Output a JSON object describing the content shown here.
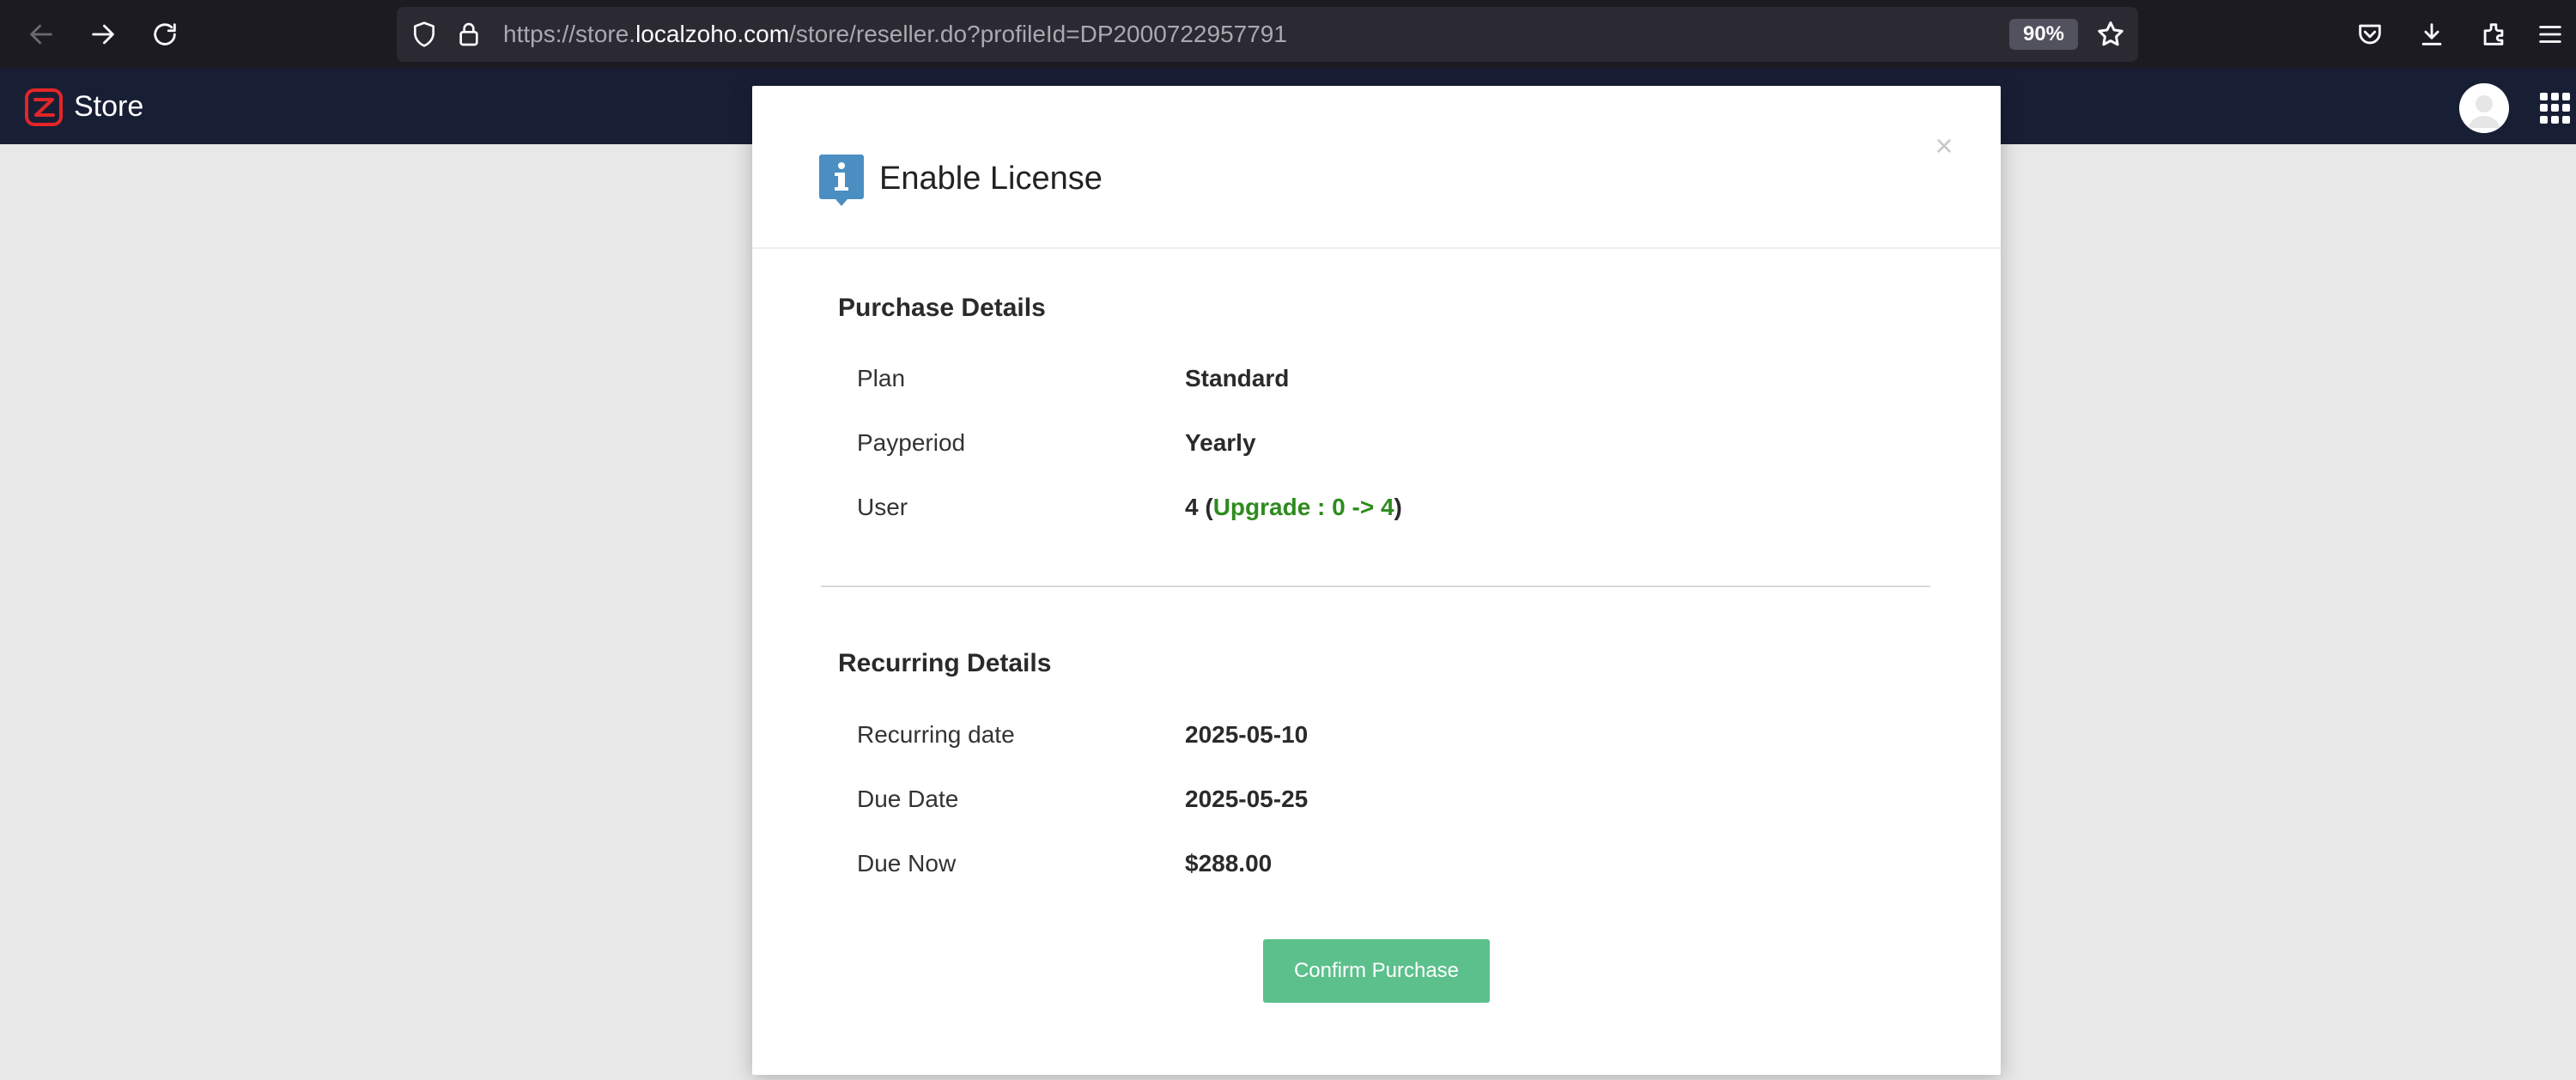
{
  "browser": {
    "url_prefix": "https://store.",
    "url_host": "localzoho.com",
    "url_path": "/store/reseller.do?profileId=DP2000722957791",
    "zoom": "90%"
  },
  "app": {
    "brand": "Store"
  },
  "modal": {
    "title": "Enable License",
    "close_symbol": "×",
    "purchase_details": {
      "title": "Purchase Details",
      "plan_label": "Plan",
      "plan_value": "Standard",
      "payperiod_label": "Payperiod",
      "payperiod_value": "Yearly",
      "user_label": "User",
      "user_count": "4",
      "user_open": " (",
      "user_upgrade": "Upgrade : 0 -> 4",
      "user_close": ")"
    },
    "recurring_details": {
      "title": "Recurring Details",
      "recurring_date_label": "Recurring date",
      "recurring_date_value": "2025-05-10",
      "due_date_label": "Due Date",
      "due_date_value": "2025-05-25",
      "due_now_label": "Due Now",
      "due_now_value": "$288.00"
    },
    "confirm_label": "Confirm Purchase"
  },
  "colors": {
    "header_bg": "#181f35",
    "confirm_bg": "#5cc08d",
    "info_icon": "#4a8ec2",
    "upgrade_text": "#2e8b1e"
  }
}
